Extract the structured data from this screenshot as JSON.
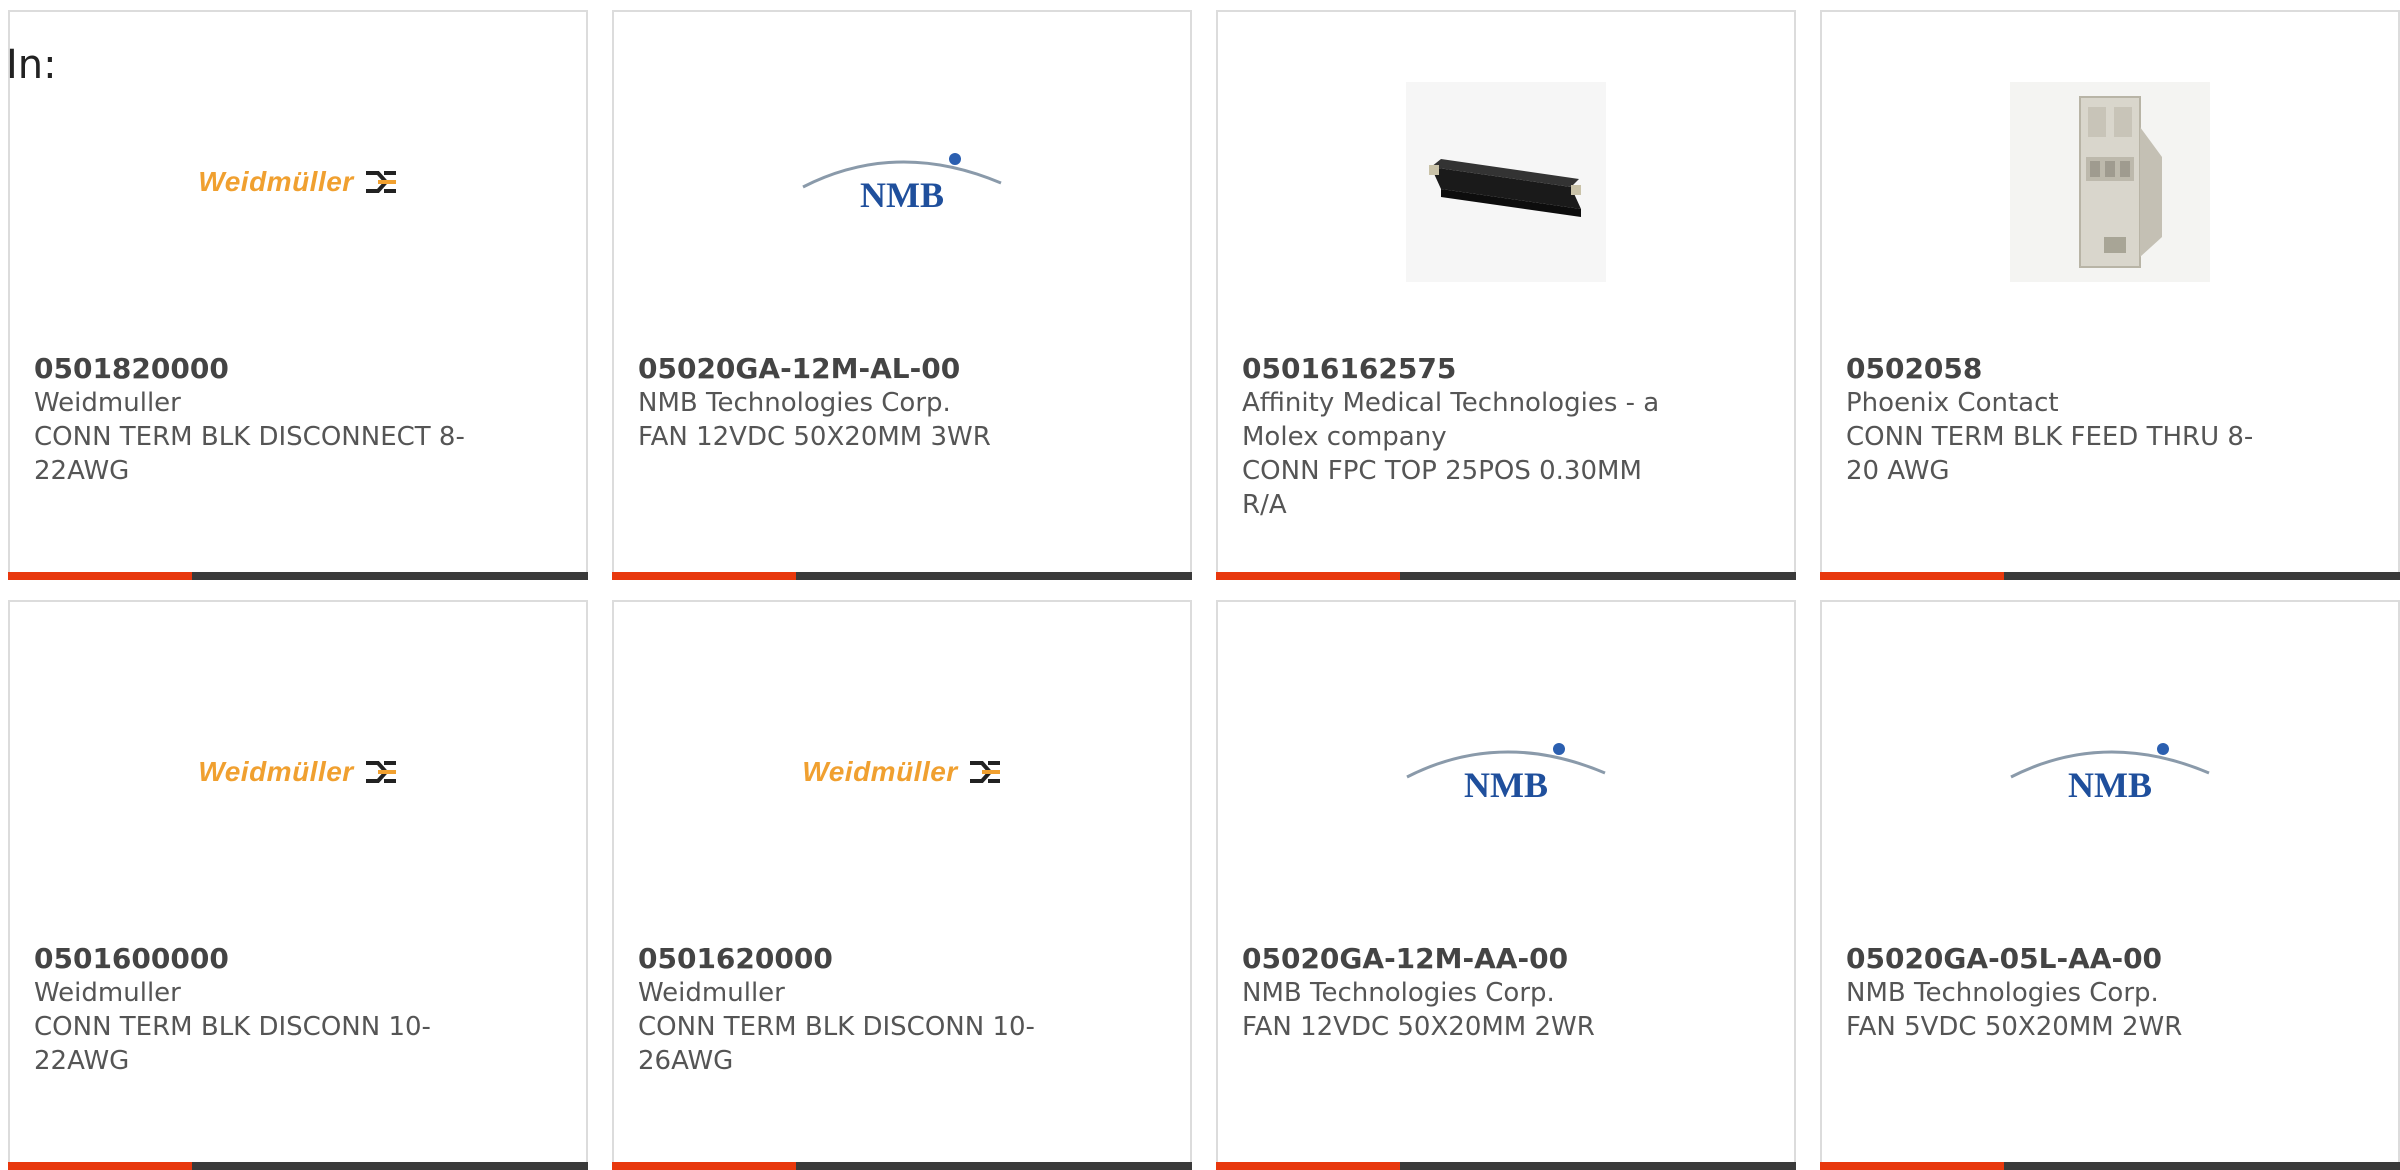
{
  "page": {
    "in_label": "In:"
  },
  "colors": {
    "accent": "#e8380d",
    "bar": "#3a3a3a",
    "weidmuller_orange": "#f0a030",
    "nmb_blue": "#1f4f9c"
  },
  "products": [
    {
      "part_number": "0501820000",
      "manufacturer": "Weidmuller",
      "description": "CONN TERM BLK DISCONNECT 8-22AWG",
      "logo": "weidmuller-logo",
      "logo_text": "Weidmüller"
    },
    {
      "part_number": "05020GA-12M-AL-00",
      "manufacturer": "NMB Technologies Corp.",
      "description": "FAN 12VDC 50X20MM 3WR",
      "logo": "nmb-logo",
      "logo_text": "NMB"
    },
    {
      "part_number": "05016162575",
      "manufacturer": "Affinity Medical Technologies - a Molex company",
      "description": "CONN FPC TOP 25POS 0.30MM R/A",
      "logo": "fpc-connector-photo",
      "logo_text": ""
    },
    {
      "part_number": "0502058",
      "manufacturer": "Phoenix Contact",
      "description": "CONN TERM BLK FEED THRU 8-20 AWG",
      "logo": "terminal-block-photo",
      "logo_text": ""
    },
    {
      "part_number": "0501600000",
      "manufacturer": "Weidmuller",
      "description": "CONN TERM BLK DISCONN 10-22AWG",
      "logo": "weidmuller-logo",
      "logo_text": "Weidmüller"
    },
    {
      "part_number": "0501620000",
      "manufacturer": "Weidmuller",
      "description": "CONN TERM BLK DISCONN 10-26AWG",
      "logo": "weidmuller-logo",
      "logo_text": "Weidmüller"
    },
    {
      "part_number": "05020GA-12M-AA-00",
      "manufacturer": "NMB Technologies Corp.",
      "description": "FAN 12VDC 50X20MM 2WR",
      "logo": "nmb-logo",
      "logo_text": "NMB"
    },
    {
      "part_number": "05020GA-05L-AA-00",
      "manufacturer": "NMB Technologies Corp.",
      "description": "FAN 5VDC 50X20MM 2WR",
      "logo": "nmb-logo",
      "logo_text": "NMB"
    }
  ]
}
